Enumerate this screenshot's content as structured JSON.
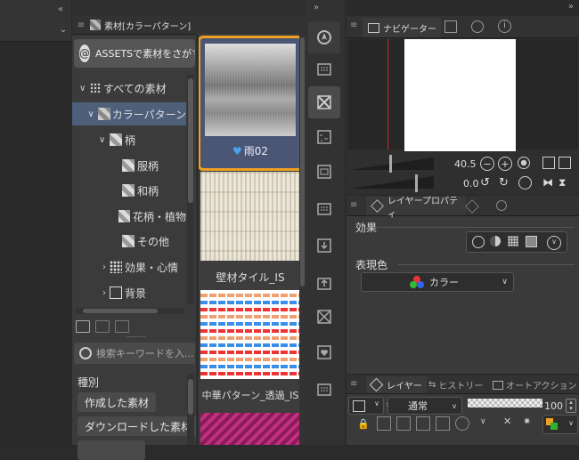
{
  "top_bar": {},
  "material_panel": {
    "tab_title": "素材[カラーパターン]",
    "assets_search_label": "ASSETSで素材をさがす",
    "tree": [
      {
        "label": "すべての素材"
      },
      {
        "label": "カラーパターン"
      },
      {
        "label": "柄"
      },
      {
        "label": "服柄"
      },
      {
        "label": "和柄"
      },
      {
        "label": "花柄・植物"
      },
      {
        "label": "その他"
      },
      {
        "label": "効果・心情"
      },
      {
        "label": "背景"
      }
    ],
    "search_placeholder": "検索キーワードを入...",
    "kind_label": "種別",
    "kind_chips": [
      "作成した素材",
      "ダウンロードした素材"
    ],
    "thumbnails": [
      {
        "label": "雨02",
        "selected": true
      },
      {
        "label": "壁材タイル_IS",
        "selected": false
      },
      {
        "label": "中華パターン_透過_IS",
        "selected": false
      }
    ]
  },
  "navigator": {
    "tab_label": "ナビゲーター",
    "zoom_value": "40.5",
    "rotate_value": "0.0"
  },
  "layer_property": {
    "tab_label": "レイヤープロパティ",
    "effect_label": "効果",
    "expression_color_label": "表現色",
    "color_select_value": "カラー"
  },
  "layer_panel": {
    "tab_layer": "レイヤー",
    "tab_history": "ヒストリー",
    "tab_auto_action": "オートアクション",
    "blend_mode": "通常",
    "opacity": "100"
  },
  "colors": {
    "selection_orange": "#f0a020",
    "accent_blue": "#3a6ea5",
    "heart_blue": "#4aa3f0"
  }
}
